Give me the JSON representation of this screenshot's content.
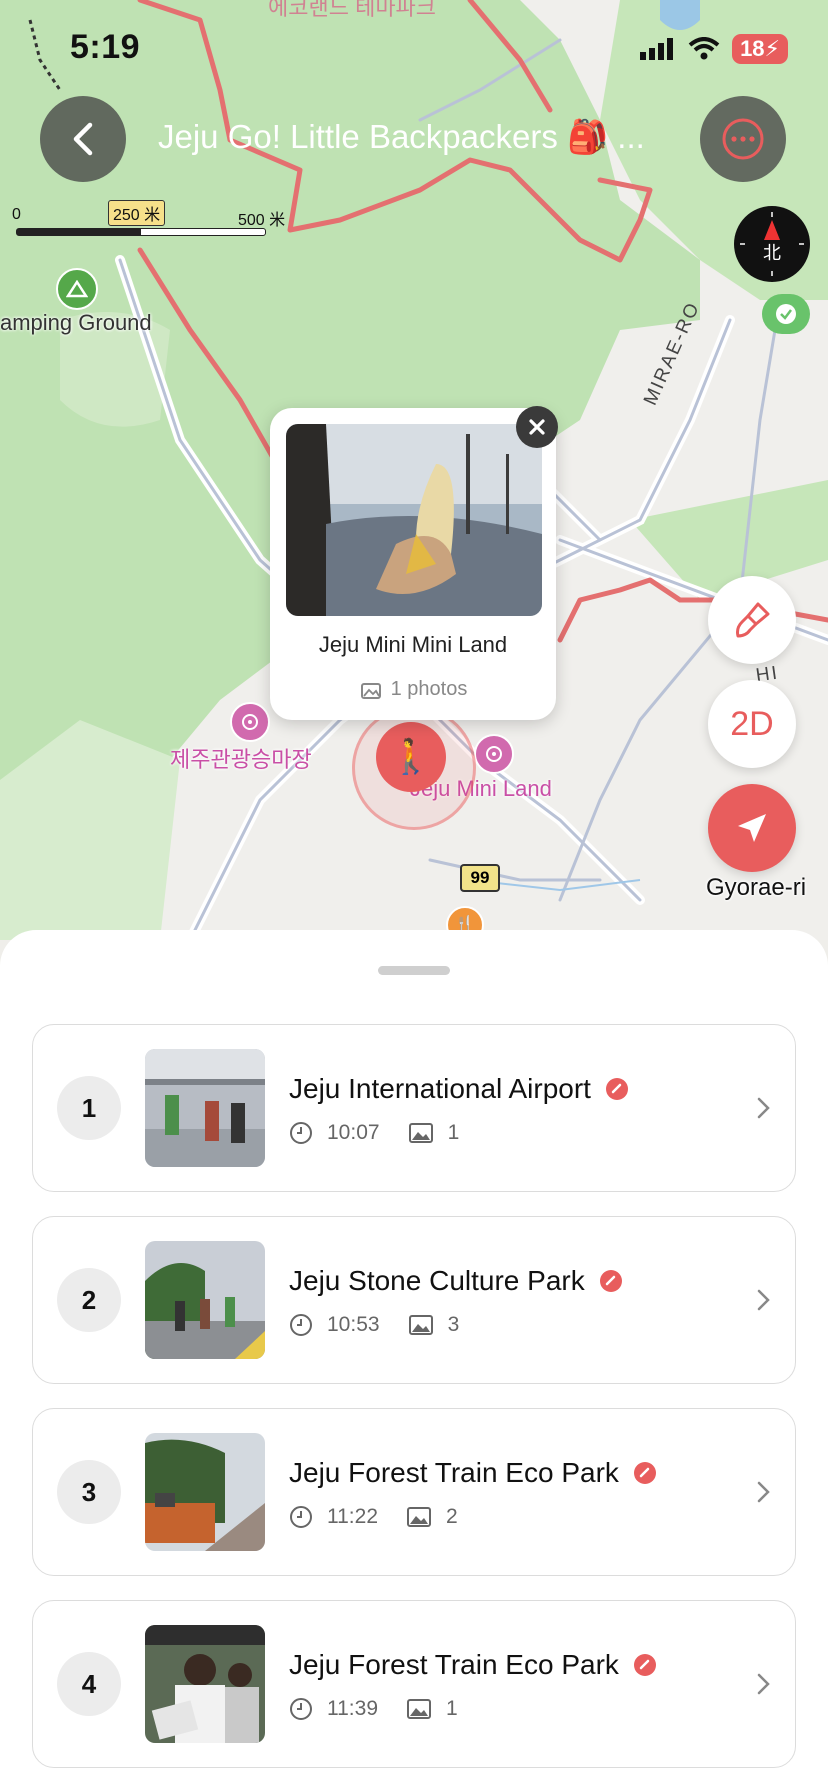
{
  "status_bar": {
    "time": "5:19",
    "battery": "18"
  },
  "header": {
    "title": "Jeju Go! Little Backpackers 🎒 ..."
  },
  "map": {
    "top_faded_text": "에코랜드 테마파크",
    "scale": {
      "zero": "0",
      "mid": "250 米",
      "max": "500 米"
    },
    "compass_label": "北",
    "camping_label": "amping Ground",
    "road_name": "MIRAE-RO",
    "road_hi": "HI",
    "poi_korean": "제주관광승마장",
    "poi_mini_land": "Jeju Mini Land",
    "route_badge": "99",
    "place_label": "Gyorae-ri",
    "mode_button": "2D",
    "popup": {
      "title": "Jeju Mini Mini Land",
      "photos": "1 photos"
    }
  },
  "stops": [
    {
      "num": "1",
      "title": "Jeju International Airport",
      "time": "10:07",
      "photos": "1"
    },
    {
      "num": "2",
      "title": "Jeju Stone Culture Park",
      "time": "10:53",
      "photos": "3"
    },
    {
      "num": "3",
      "title": "Jeju Forest Train Eco Park",
      "time": "11:22",
      "photos": "2"
    },
    {
      "num": "4",
      "title": "Jeju Forest Train Eco Park",
      "time": "11:39",
      "photos": "1"
    }
  ],
  "colors": {
    "accent": "#e85d5d",
    "map_green": "#bfe2b3",
    "map_base": "#efeeea"
  }
}
